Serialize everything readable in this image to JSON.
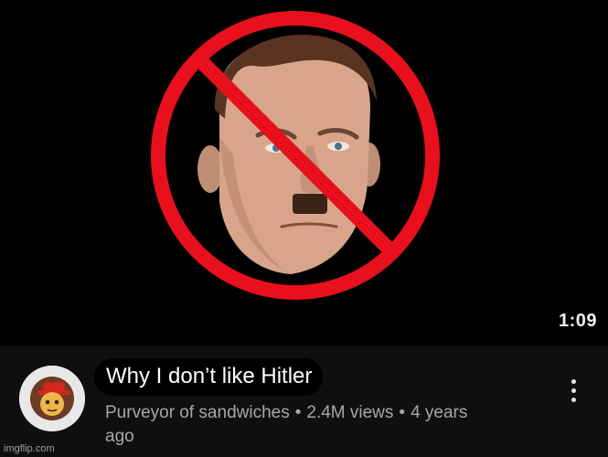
{
  "video": {
    "duration": "1:09",
    "title": "Why I don’t like Hitler",
    "channel": "Purveyor of sandwiches",
    "views": "2.4M views",
    "age_line1": "4 years",
    "age_line2": "ago",
    "separator": "•"
  },
  "watermark": "imgflip.com",
  "icons": {
    "prohibition": "prohibition-sign-icon",
    "menu": "more-vertical-icon",
    "avatar": "channel-avatar"
  },
  "colors": {
    "background": "#0f0f0f",
    "prohibition_red": "#e8101c",
    "meta_text": "#a7a7a7",
    "title_text": "#ffffff"
  }
}
